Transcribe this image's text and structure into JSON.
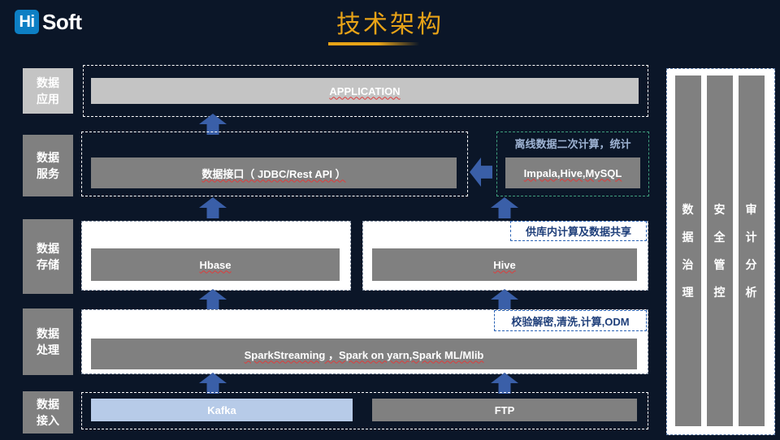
{
  "brand": {
    "mark": "Hi",
    "name": "Soft"
  },
  "header": {
    "title": "技术架构"
  },
  "layers": [
    {
      "id": "application",
      "line1": "数据",
      "line2": "应用"
    },
    {
      "id": "service",
      "line1": "数据",
      "line2": "服务"
    },
    {
      "id": "storage",
      "line1": "数据",
      "line2": "存储"
    },
    {
      "id": "processing",
      "line1": "数据",
      "line2": "处理"
    },
    {
      "id": "ingestion",
      "line1": "数据",
      "line2": "接入"
    }
  ],
  "boxes": {
    "application": "APPLICATION",
    "data_interface": "数据接口（ JDBC/Rest API ）",
    "offline_engines": "Impala,Hive,MySQL",
    "hbase": "Hbase",
    "hive": "Hive",
    "spark": "SparkStreaming ，Spark on yarn,Spark ML/Mlib",
    "kafka": "Kafka",
    "ftp": "FTP"
  },
  "callouts": {
    "offline": "离线数据二次计算，统计",
    "in_db": "供库内计算及数据共享",
    "etl": "校验解密,清洗,计算,ODM"
  },
  "governance": [
    {
      "id": "data-governance",
      "chars": [
        "数",
        "据",
        "治",
        "理"
      ]
    },
    {
      "id": "security-control",
      "chars": [
        "安",
        "全",
        "管",
        "控"
      ]
    },
    {
      "id": "audit-analysis",
      "chars": [
        "审",
        "计",
        "分",
        "析"
      ]
    }
  ],
  "colors": {
    "background": "#0b1628",
    "accent": "#e8a317",
    "brand_blue": "#0d7fc4",
    "arrow": "#3a5fa8",
    "gray_box": "#808080",
    "kafka_blue": "#b7cbe8",
    "green_dash": "#3f9e7d",
    "callout_text": "#1f3f7a"
  }
}
